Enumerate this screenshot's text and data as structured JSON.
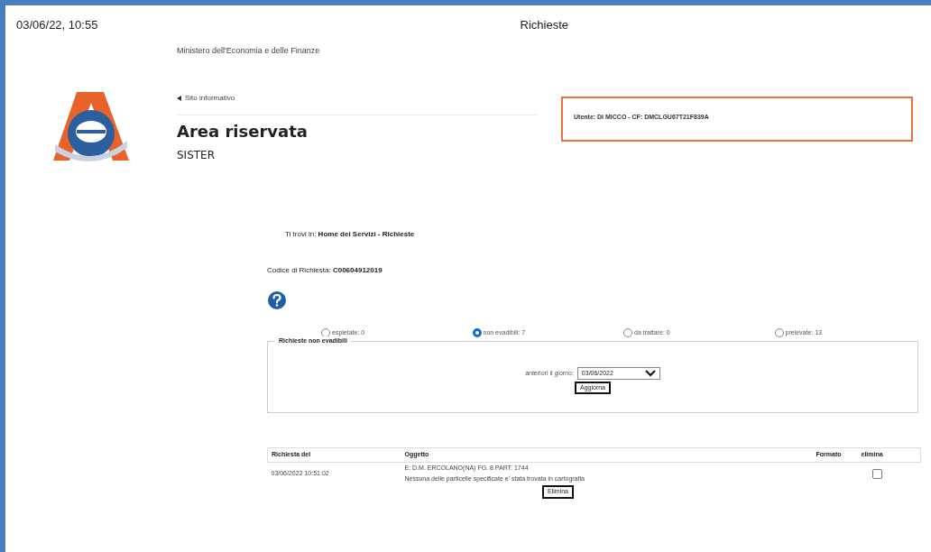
{
  "print_header": {
    "date_time": "03/06/22, 10:55",
    "title": "Richieste"
  },
  "header": {
    "ministry": "Ministero dell'Economia e delle Finanze",
    "back_link": "Sito informativo",
    "title": "Area riservata",
    "subtitle": "SISTER",
    "user_info": "Utente: DI MICCO - CF: DMCLGU67T21F839A"
  },
  "breadcrumb": {
    "label": "Ti trovi in:",
    "path": "Home dei Servizi - Richieste"
  },
  "request_code": {
    "label": "Codice di Richiesta:",
    "value": "C00604912019"
  },
  "filters": [
    {
      "label": "espletate: 0",
      "selected": false
    },
    {
      "label": "non evadibili: 7",
      "selected": true
    },
    {
      "label": "da trattare: 0",
      "selected": false
    },
    {
      "label": "prelevate: 13",
      "selected": false
    }
  ],
  "panel": {
    "legend": "Richieste non evadibili",
    "date_label": "anteriori il giorno:",
    "date_value": "03/06/2022",
    "button": "Aggiorna"
  },
  "table": {
    "columns": [
      "Richiesta del",
      "Oggetto",
      "Formato",
      "elimina"
    ],
    "rows": [
      {
        "date": "03/06/2022 10:51:02",
        "object_lines": [
          "E: D.M. ERCOLANO(NA) FG. 8 PART. 1744",
          "Nessuna delle particelle specificate e' stata trovata in cartografia"
        ],
        "checked": false
      }
    ]
  },
  "delete_button": "Elimina"
}
